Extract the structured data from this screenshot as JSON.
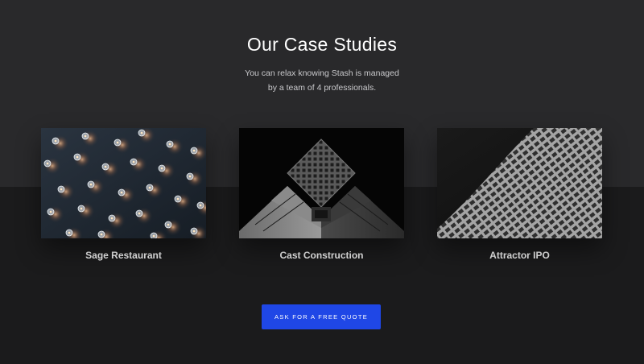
{
  "section": {
    "title": "Our Case Studies",
    "subtitle_line1": "You can relax knowing Stash is managed",
    "subtitle_line2": "by a team of 4 professionals."
  },
  "cards": [
    {
      "label": "Sage Restaurant",
      "image": "hanging-lightbulbs-photo"
    },
    {
      "label": "Cast Construction",
      "image": "brutalist-building-photo"
    },
    {
      "label": "Attractor IPO",
      "image": "skyscraper-facade-photo"
    }
  ],
  "cta": {
    "label": "ASK FOR A FREE QUOTE",
    "color": "#1f47e6"
  },
  "colors": {
    "background_top": "#29292b",
    "background_bottom": "#1b1b1c"
  }
}
